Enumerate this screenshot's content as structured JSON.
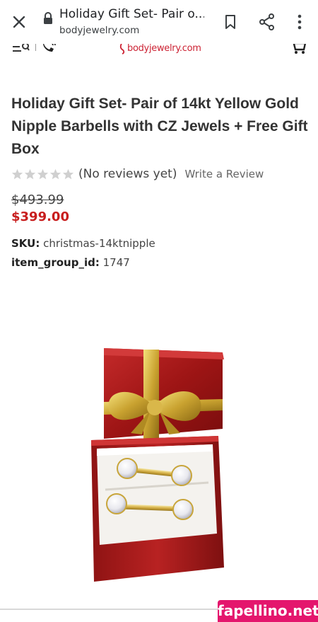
{
  "browser": {
    "page_title": "Holiday Gift Set- Pair o...",
    "url": "bodyjewelry.com",
    "icons": [
      "close-icon",
      "lock-icon",
      "bookmark-icon",
      "share-icon",
      "more-vert-icon"
    ]
  },
  "site": {
    "logo_text": "bodyjewelry.com",
    "brand_color": "#cc2233",
    "icons": [
      "menu-icon",
      "phone-icon",
      "cart-icon"
    ]
  },
  "product": {
    "title": "Holiday Gift Set- Pair of 14kt Yellow Gold Nipple Barbells with CZ Jewels + Free Gift Box",
    "rating": 0,
    "rating_max": 5,
    "reviews_label": "(No reviews yet)",
    "write_review": "Write a Review",
    "price_old": "$493.99",
    "price_new": "$399.00",
    "price_new_color": "#c81e1e",
    "sku_label": "SKU:",
    "sku_value": "christmas-14ktnipple",
    "group_label": "item_group_id:",
    "group_value": "1747"
  },
  "watermark": {
    "text": "fapellino.net",
    "color": "#e4166d"
  }
}
